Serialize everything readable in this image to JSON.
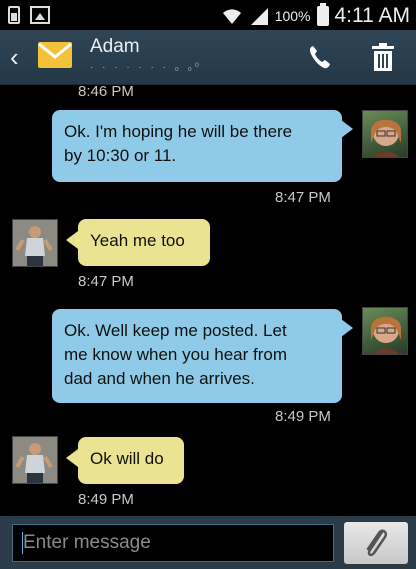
{
  "status_bar": {
    "battery_percent": "100%",
    "time": "4:11 AM"
  },
  "header": {
    "contact_name": "Adam",
    "contact_number": "· · · · · · ·  ₀  ₀⁰"
  },
  "messages": [
    {
      "direction": "in",
      "text": "",
      "time": "8:46 PM"
    },
    {
      "direction": "out",
      "lines": [
        "Ok. I'm hoping he will be there",
        "by 10:30 or 11."
      ],
      "time": "8:47 PM"
    },
    {
      "direction": "in",
      "lines": [
        "Yeah me too"
      ],
      "time": "8:47 PM"
    },
    {
      "direction": "out",
      "lines": [
        "Ok. Well keep me posted. Let",
        "me know when you hear from",
        "dad and when he arrives."
      ],
      "time": "8:49 PM"
    },
    {
      "direction": "in",
      "lines": [
        "Ok will do"
      ],
      "time": "8:49 PM"
    }
  ],
  "composer": {
    "placeholder": "Enter message"
  },
  "colors": {
    "outgoing_bubble": "#8fcbe8",
    "incoming_bubble": "#e9e392",
    "action_bar": "#2f4556"
  }
}
